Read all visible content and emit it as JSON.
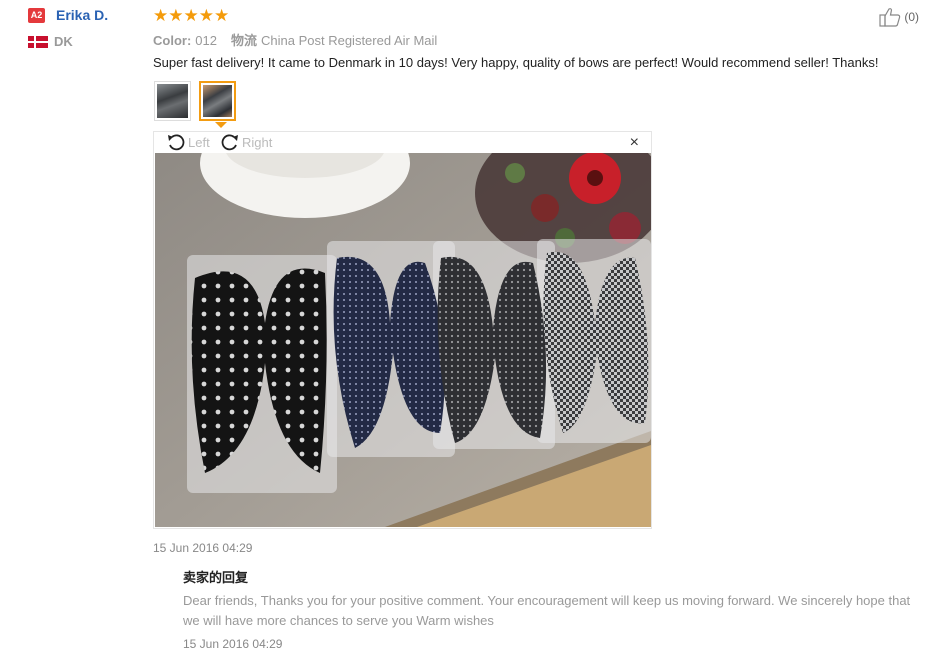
{
  "reviewer": {
    "level_badge": "A2",
    "name": "Erika D.",
    "country": "DK"
  },
  "rating": {
    "stars": "★★★★★",
    "value": 5
  },
  "helpful": {
    "count": "(0)"
  },
  "meta": {
    "color_label": "Color:",
    "color_value": "012",
    "shipping_label": "物流",
    "shipping_value": "China Post Registered Air Mail"
  },
  "review": {
    "text": "Super fast delivery! It came to Denmark in 10 days! Very happy, quality of bows are perfect! Would recommend seller! Thanks!",
    "date": "15 Jun 2016 04:29"
  },
  "viewer": {
    "rotate_left": "Left",
    "rotate_right": "Right",
    "close": "×"
  },
  "reply": {
    "title": "卖家的回复",
    "text": "Dear friends, Thanks you for your positive comment. Your encouragement will keep us moving forward. We sincerely hope that we will have more chances to serve you Warm wishes",
    "date": "15 Jun 2016 04:29"
  },
  "colors": {
    "star": "#f49b0b",
    "name_link": "#2a62b3",
    "badge": "#e4393c",
    "active_thumb": "#f39c12"
  }
}
